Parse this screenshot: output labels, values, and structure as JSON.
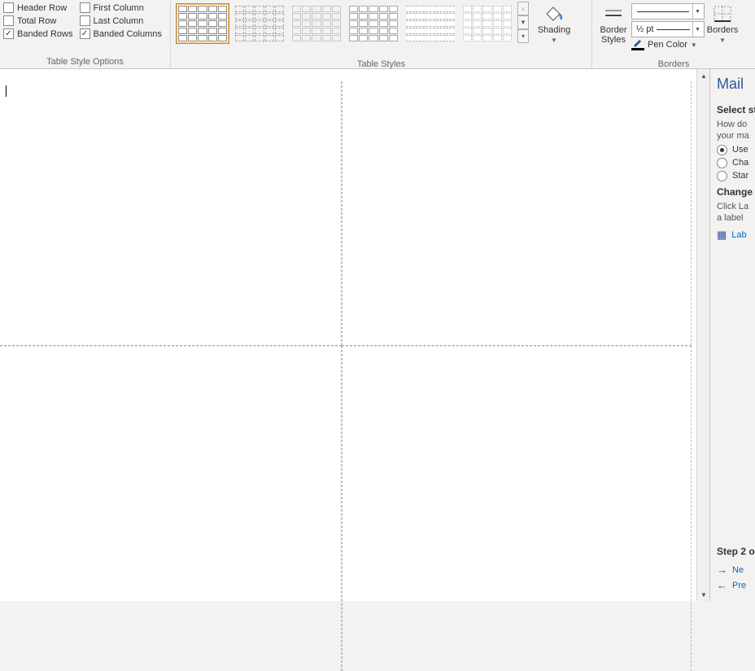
{
  "ribbon": {
    "table_style_options": {
      "label": "Table Style Options",
      "header_row": {
        "label": "Header Row",
        "checked": false
      },
      "total_row": {
        "label": "Total Row",
        "checked": false
      },
      "banded_rows": {
        "label": "Banded Rows",
        "checked": true
      },
      "first_column": {
        "label": "First Column",
        "checked": false
      },
      "last_column": {
        "label": "Last Column",
        "checked": false
      },
      "banded_columns": {
        "label": "Banded Columns",
        "checked": true
      }
    },
    "table_styles": {
      "label": "Table Styles"
    },
    "shading": {
      "label": "Shading"
    },
    "border_styles": {
      "label": "Border\nStyles"
    },
    "borders_group": {
      "label": "Borders"
    },
    "line_weight": {
      "value": "½ pt"
    },
    "pen_color": {
      "label": "Pen Color"
    },
    "borders_btn": {
      "label": "Borders"
    }
  },
  "mail": {
    "title": "Mail",
    "select_heading": "Select st",
    "help1": "How do",
    "help2": "your ma",
    "opt_use": "Use",
    "opt_cha": "Cha",
    "opt_star": "Star",
    "change_heading": "Change d",
    "change1": "Click La",
    "change2": "a label",
    "label_link": "Lab",
    "step_heading": "Step 2 o",
    "next": "Ne",
    "prev": "Pre"
  }
}
